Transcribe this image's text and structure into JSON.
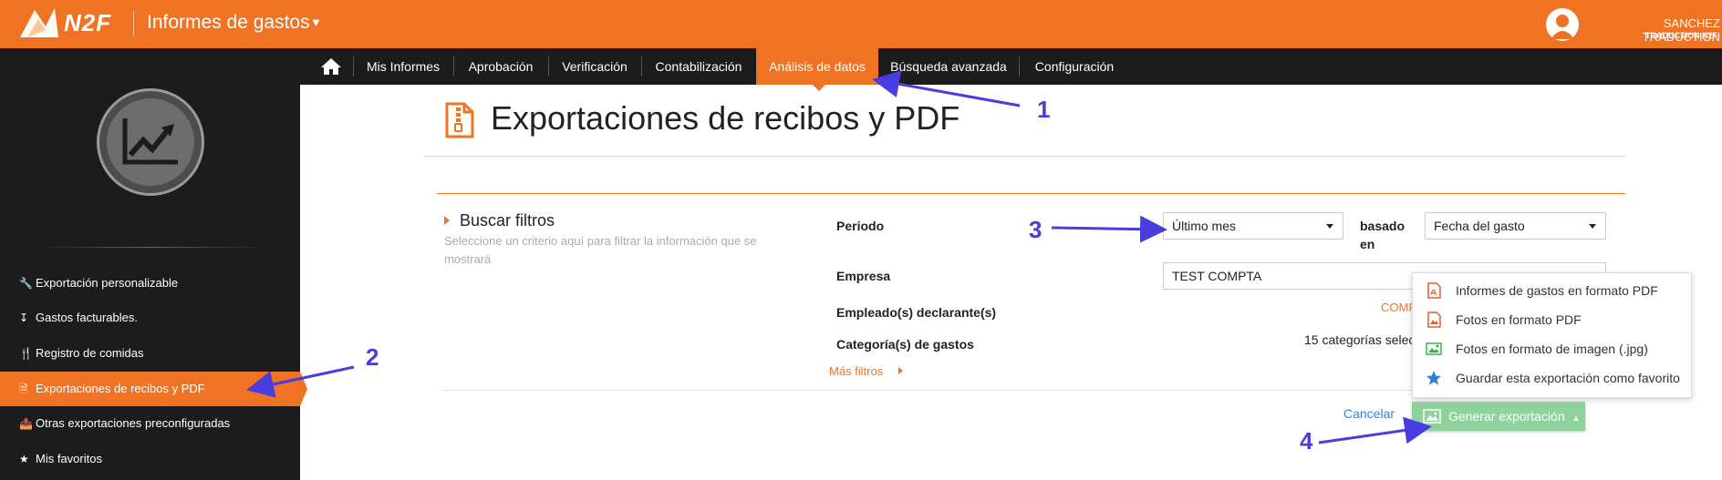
{
  "header": {
    "logo_text": "N2F",
    "app_title": "Informes de gastos",
    "user_name": "SANCHEZ TRADUCTION",
    "user_sub": "TRADUCTION N2F",
    "accent_color": "#f07223"
  },
  "nav": {
    "home_icon": "home-icon",
    "items": [
      {
        "label": "Mis Informes"
      },
      {
        "label": "Aprobación"
      },
      {
        "label": "Verificación"
      },
      {
        "label": "Contabilización"
      },
      {
        "label": "Análisis de datos",
        "active": true
      },
      {
        "label": "Búsqueda avanzada"
      },
      {
        "label": "Configuración"
      }
    ]
  },
  "sidebar": {
    "hero_icon": "line-chart-icon",
    "items": [
      {
        "label": "Exportación personalizable",
        "icon": "wrench-icon"
      },
      {
        "label": "Gastos facturables.",
        "icon": "arrow-down-icon"
      },
      {
        "label": "Registro de comidas",
        "icon": "cutlery-icon"
      },
      {
        "label": "Exportaciones de recibos y PDF",
        "icon": "file-icon",
        "active": true
      },
      {
        "label": "Otras exportaciones preconfiguradas",
        "icon": "export-icon"
      },
      {
        "label": "Mis favoritos",
        "icon": "star-icon"
      }
    ]
  },
  "main": {
    "title": "Exportaciones de recibos y PDF",
    "filters": {
      "heading": "Buscar filtros",
      "description": "Seleccione un criterio aquí para filtrar la información que se mostrará",
      "periodo_label": "Periodo",
      "periodo_value": "Último mes",
      "basado_label_1": "basado",
      "basado_label_2": "en",
      "basado_value": "Fecha del gasto",
      "empresa_label": "Empresa",
      "empresa_value": "TEST COMPTA",
      "empleado_label": "Empleado(s) declarante(s)",
      "empleado_value": "COMP",
      "categoria_label": "Categoría(s) de gastos",
      "categoria_value": "15 categorías selec",
      "mas_filtros": "Más filtros"
    },
    "dropdown": [
      {
        "label": "Informes de gastos en formato PDF",
        "icon": "pdf-icon"
      },
      {
        "label": "Fotos en formato PDF",
        "icon": "pdf-image-icon"
      },
      {
        "label": "Fotos en formato de imagen (.jpg)",
        "icon": "image-icon"
      },
      {
        "label": "Guardar esta exportación como favorito",
        "icon": "star-icon"
      }
    ],
    "cancel_label": "Cancelar",
    "generate_label": "Generar exportación"
  },
  "annotations": [
    "1",
    "2",
    "3",
    "4"
  ]
}
